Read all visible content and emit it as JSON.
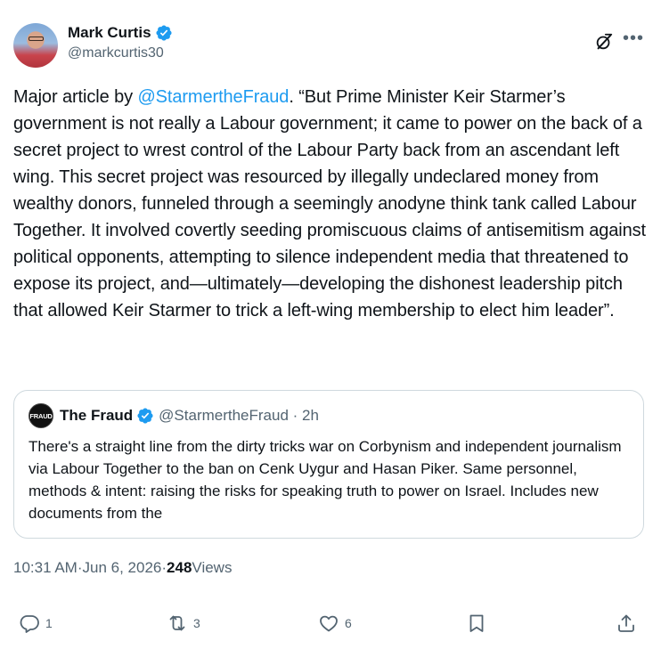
{
  "author": {
    "display_name": "Mark Curtis",
    "handle": "@markcurtis30"
  },
  "post": {
    "intro": "Major article by ",
    "mention": "@StarmertheFraud",
    "text": ". “But Prime Minister Keir Starmer’s government is not really a Labour government; it came to power on the back of a secret project to wrest control of the Labour Party back from an ascendant left wing. This secret project was resourced by illegally undeclared money from wealthy donors, funneled through a seemingly anodyne think tank called Labour Together. It involved covertly seeding promiscuous claims of antisemitism against political opponents, attempting to silence independent media that threatened to expose its project, and—ultimately—developing the dishonest leadership pitch that allowed Keir Starmer to trick a left-wing membership to elect him leader”."
  },
  "quoted_post": {
    "avatar_text": "FRAUD",
    "display_name": "The Fraud",
    "handle": "@StarmertheFraud",
    "separator": " · ",
    "time": "2h",
    "text": "There's a straight line from the dirty tricks war on Corbynism and independent journalism via Labour Together to the ban on Cenk Uygur and Hasan Piker. Same personnel, methods & intent:  raising the risks for speaking truth to power on Israel. Includes new documents from the"
  },
  "meta": {
    "time": "10:31 AM",
    "sep1": " · ",
    "date": "Jun 6, 2026",
    "sep2": " · ",
    "views_count": "248",
    "views_label": " Views"
  },
  "actions": {
    "replies": "1",
    "reposts": "3",
    "likes": "6"
  },
  "colors": {
    "accent": "#1d9bf0",
    "text": "#0f1419",
    "secondary": "#536471",
    "border": "#cfd9de"
  },
  "icons": [
    "verified-badge-icon",
    "grok-icon",
    "more-icon",
    "reply-icon",
    "repost-icon",
    "like-icon",
    "bookmark-icon",
    "share-icon"
  ]
}
